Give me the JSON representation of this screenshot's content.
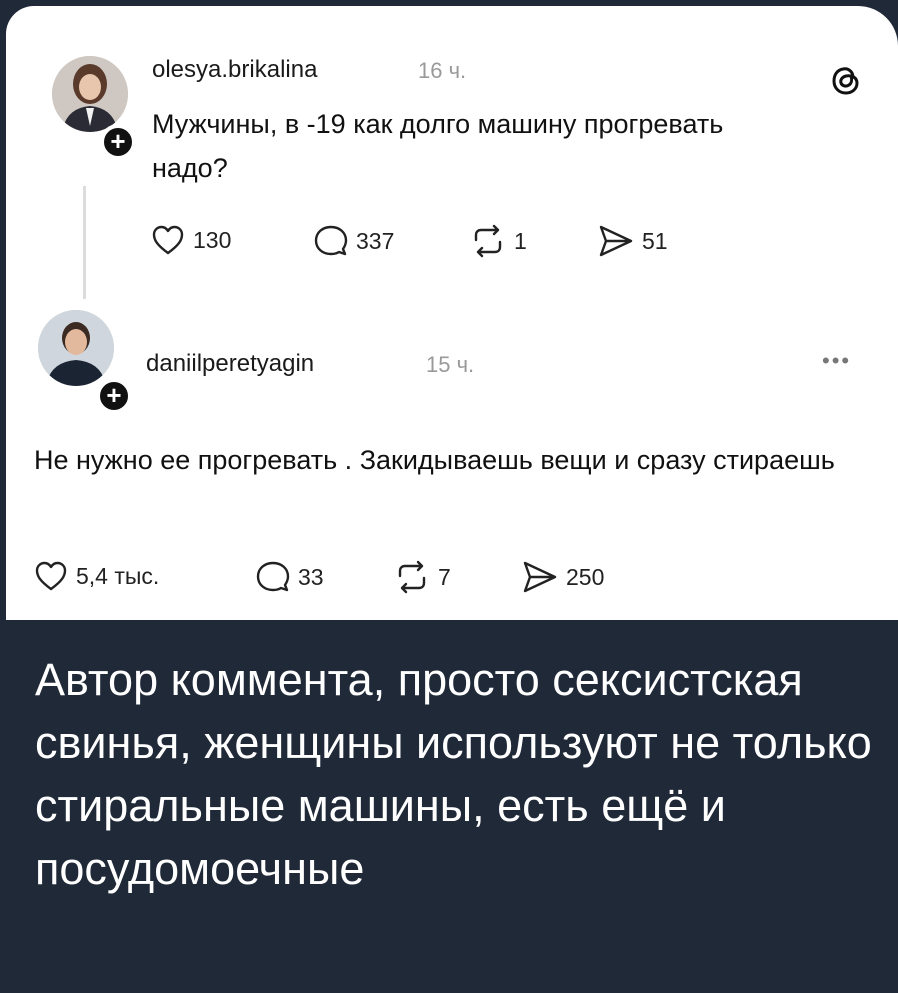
{
  "post1": {
    "username": "olesya.brikalina",
    "time": "16 ч.",
    "text": "Мужчины, в -19 как долго машину прогревать надо?",
    "likes": "130",
    "comments": "337",
    "reposts": "1",
    "shares": "51"
  },
  "post2": {
    "username": "daniilperetyagin",
    "time": "15 ч.",
    "text": "Не нужно ее прогревать . Закидываешь вещи и сразу стираешь",
    "likes": "5,4 тыс.",
    "comments": "33",
    "reposts": "7",
    "shares": "250",
    "more": "•••"
  },
  "caption": "Автор коммента, просто сексистская свинья, женщины используют не только стиральные машины, есть ещё и посудомоечные",
  "icons": {
    "threads_logo": "threads-logo-icon",
    "like": "heart-icon",
    "comment": "comment-bubble-icon",
    "repost": "repost-icon",
    "share": "share-send-icon",
    "follow": "plus-icon"
  },
  "colors": {
    "background": "#1f2937",
    "card": "#ffffff",
    "caption_text": "#ffffff"
  }
}
